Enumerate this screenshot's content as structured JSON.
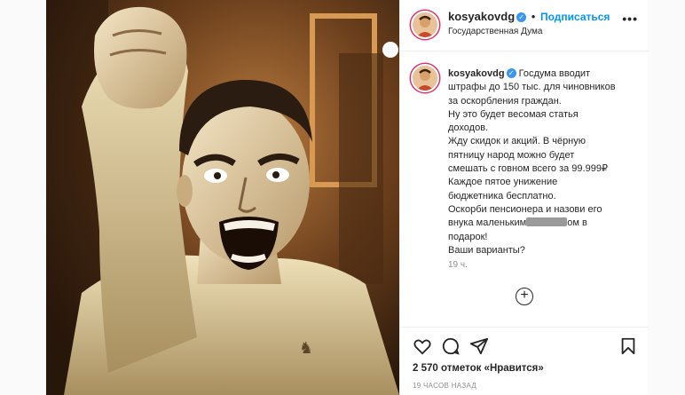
{
  "post": {
    "username": "kosyakovdg",
    "follow_label": "Подписаться",
    "location": "Государственная Дума",
    "more_label": "•••"
  },
  "caption": {
    "username": "kosyakovdg",
    "lines": [
      "Госдума вводит",
      "штрафы до 150 тыс. для чиновников",
      "за оскорбления граждан.",
      "Ну это будет весомая статья",
      "доходов.",
      "Жду скидок и акций. В чёрную",
      "пятницу народ можно будет",
      "смешать с говном всего за 99.999₽",
      "Каждое пятое унижение",
      "бюджетника бесплатно.",
      "Оскорби пенсионера и назови его"
    ],
    "line_redact_pre": "внука маленьким",
    "line_redact_post": "ом в",
    "lines_end": [
      "подарок!",
      "Ваши варианты?"
    ],
    "time": "19 ч."
  },
  "load_more_label": "+",
  "footer": {
    "likes": "2 570 отметок «Нравится»",
    "posted": "19 ЧАСОВ НАЗАД"
  },
  "icons": {
    "heart": "heart-icon",
    "comment": "comment-icon",
    "share": "share-icon",
    "save": "bookmark-icon"
  },
  "colors": {
    "follow": "#0095f6",
    "verified": "#3897f0",
    "muted": "#8e8e8e"
  }
}
